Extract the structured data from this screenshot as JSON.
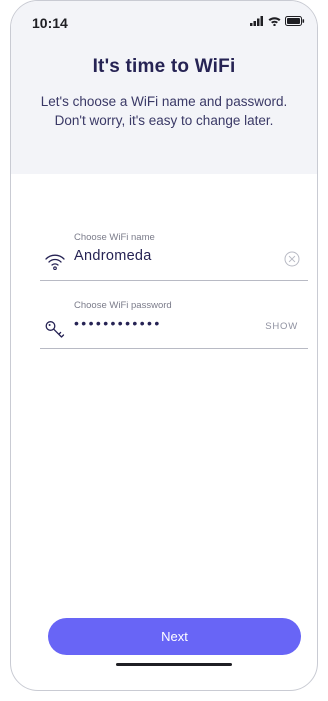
{
  "status_bar": {
    "time": "10:14",
    "icons": [
      "signal-icon",
      "wifi-icon",
      "battery-icon"
    ]
  },
  "header": {
    "title": "It's time to WiFi",
    "subtitle_line1": "Let's choose a WiFi name and password.",
    "subtitle_line2": "Don't worry, it's easy to change later."
  },
  "form": {
    "name_field": {
      "label": "Choose WiFi name",
      "value": "Andromeda",
      "icon": "wifi-icon",
      "action_icon": "clear-icon"
    },
    "password_field": {
      "label": "Choose WiFi password",
      "value": "••••••••••••",
      "icon": "key-icon",
      "toggle_label": "SHOW"
    }
  },
  "actions": {
    "next_label": "Next"
  },
  "colors": {
    "accent": "#6865f6",
    "heading": "#262354",
    "header_bg": "#f3f4f8"
  }
}
